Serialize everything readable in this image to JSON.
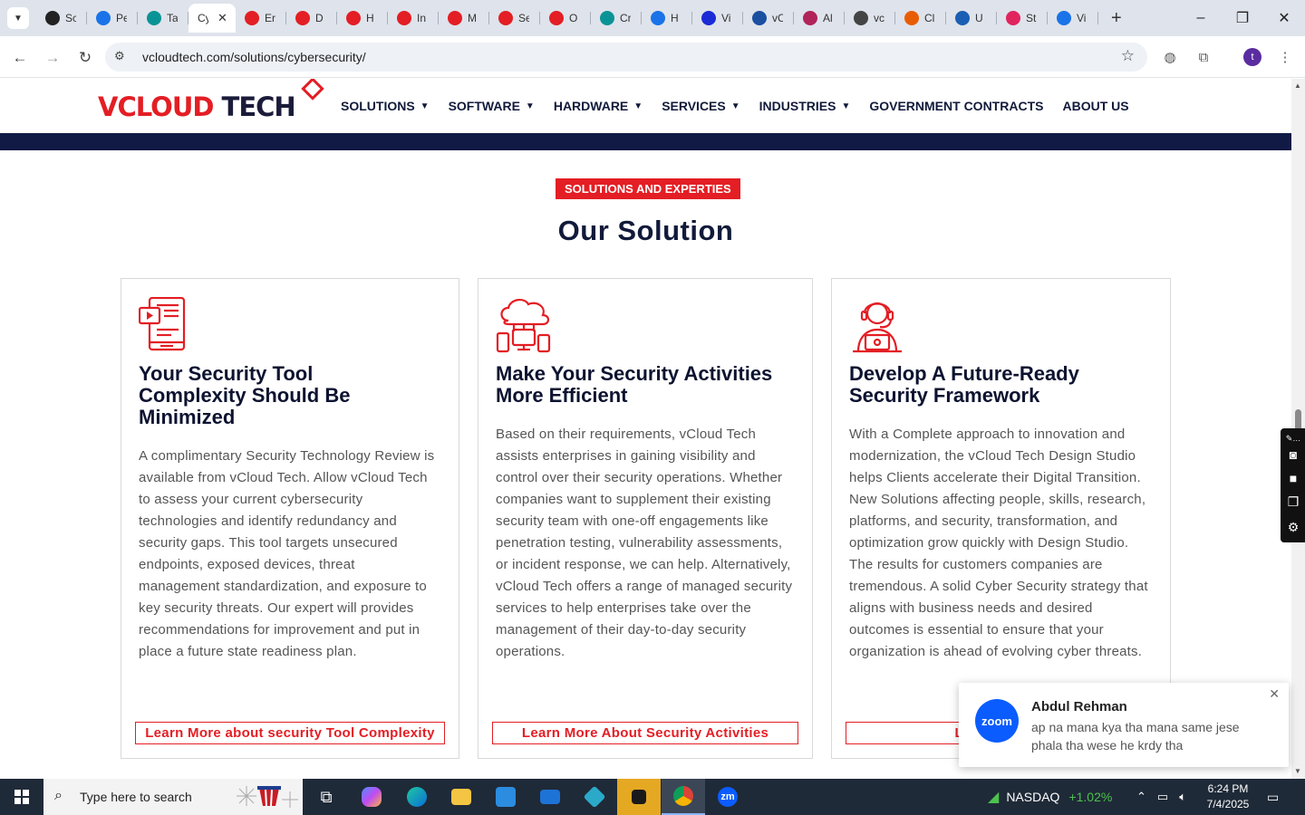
{
  "browser": {
    "tabs": [
      {
        "label": "Sc",
        "color": "#222222"
      },
      {
        "label": "Pe",
        "color": "#1a73e8"
      },
      {
        "label": "Ta",
        "color": "#0a9396"
      },
      {
        "label": "Cy",
        "color": "#ffffff",
        "active": true
      },
      {
        "label": "Er",
        "color": "#e31e24"
      },
      {
        "label": "D",
        "color": "#e31e24"
      },
      {
        "label": "H",
        "color": "#e31e24"
      },
      {
        "label": "In",
        "color": "#e31e24"
      },
      {
        "label": "M",
        "color": "#e31e24"
      },
      {
        "label": "Se",
        "color": "#e31e24"
      },
      {
        "label": "O",
        "color": "#e31e24"
      },
      {
        "label": "Cr",
        "color": "#0a9396"
      },
      {
        "label": "H",
        "color": "#1a73e8"
      },
      {
        "label": "Vi",
        "color": "#1b2bd6"
      },
      {
        "label": "vC",
        "color": "#1b4fa0"
      },
      {
        "label": "Al",
        "color": "#b0245a"
      },
      {
        "label": "vc",
        "color": "#444444"
      },
      {
        "label": "Cl",
        "color": "#e85d04"
      },
      {
        "label": "U",
        "color": "#1a5fb4"
      },
      {
        "label": "St",
        "color": "#e0245e"
      },
      {
        "label": "Vi",
        "color": "#1a73e8"
      }
    ],
    "url": "vcloudtech.com/solutions/cybersecurity/"
  },
  "site": {
    "logo_main": "VCLOUD",
    "logo_tech": " TECH",
    "nav": [
      {
        "label": "SOLUTIONS",
        "dropdown": true
      },
      {
        "label": "SOFTWARE",
        "dropdown": true
      },
      {
        "label": "HARDWARE",
        "dropdown": true
      },
      {
        "label": "SERVICES",
        "dropdown": true
      },
      {
        "label": "INDUSTRIES",
        "dropdown": true
      },
      {
        "label": "GOVERNMENT CONTRACTS",
        "dropdown": false
      },
      {
        "label": "ABOUT US",
        "dropdown": false
      }
    ]
  },
  "section": {
    "badge": "SOLUTIONS AND EXPERTIES",
    "title": "Our Solution"
  },
  "cards": [
    {
      "icon": "tablet-video-icon",
      "title": "Your Security Tool Complexity Should Be Minimized",
      "body": "A complimentary Security Technology Review is available from vCloud Tech. Allow vCloud Tech to assess your current cybersecurity technologies and identify redundancy and security gaps. This tool targets unsecured endpoints, exposed devices, threat management standardization, and exposure to key security threats. Our expert will provides recommendations for improvement and put in place a future state readiness plan.",
      "link": "Learn More about security Tool Complexity"
    },
    {
      "icon": "cloud-devices-icon",
      "title": "Make Your Security Activities More Efficient",
      "body": "Based on their requirements, vCloud Tech assists enterprises in gaining visibility and control over their security operations. Whether companies want to supplement their existing security team with one-off engagements like penetration testing, vulnerability assessments, or incident response, we can help. Alternatively, vCloud Tech offers a range of managed security services to help enterprises take over the management of their day-to-day security operations.",
      "link": "Learn More About Security Activities"
    },
    {
      "icon": "support-agent-icon",
      "title": "Develop A Future-Ready Security Framework",
      "body": "With a Complete approach to innovation and modernization, the vCloud Tech Design Studio helps Clients accelerate their Digital Transition. New Solutions affecting people, skills, research, platforms, and security, transformation, and optimization grow quickly with Design Studio. The results for customers companies are tremendous. A solid Cyber Security strategy that aligns with business needs and desired outcomes is essential to ensure that your organization is ahead of evolving cyber threats.",
      "link": "Learn More A"
    }
  ],
  "toast": {
    "app_logo": "zoom",
    "sender": "Abdul Rehman",
    "message": "ap na mana kya tha mana same jese phala tha wese he krdy tha"
  },
  "taskbar": {
    "search_placeholder": "Type here to search",
    "ticker_name": "NASDAQ",
    "ticker_change": "+1.02%",
    "time": "6:24 PM",
    "date": "7/4/2025",
    "zoom_label": "zm"
  },
  "colors": {
    "brand_red": "#e31e24",
    "navy": "#111a3a",
    "ticker_green": "#4cc24c"
  }
}
